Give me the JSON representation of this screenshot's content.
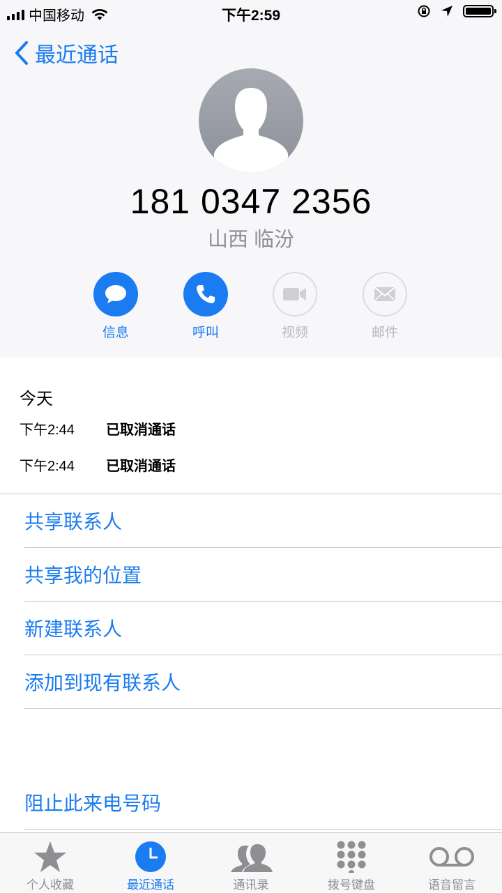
{
  "status_bar": {
    "carrier": "中国移动",
    "time": "下午2:59"
  },
  "nav": {
    "back_label": "最近通话"
  },
  "contact": {
    "number": "181 0347 2356",
    "location": "山西 临汾"
  },
  "actions": [
    {
      "label": "信息",
      "enabled": true
    },
    {
      "label": "呼叫",
      "enabled": true
    },
    {
      "label": "视频",
      "enabled": false
    },
    {
      "label": "邮件",
      "enabled": false
    }
  ],
  "history": {
    "day": "今天",
    "calls": [
      {
        "time": "下午2:44",
        "status": "已取消通话"
      },
      {
        "time": "下午2:44",
        "status": "已取消通话"
      }
    ]
  },
  "options": [
    "共享联系人",
    "共享我的位置",
    "新建联系人",
    "添加到现有联系人"
  ],
  "block": "阻止此来电号码",
  "tabs": [
    {
      "label": "个人收藏",
      "icon": "star-icon",
      "selected": false
    },
    {
      "label": "最近通话",
      "icon": "clock-icon",
      "selected": true
    },
    {
      "label": "通讯录",
      "icon": "contacts-icon",
      "selected": false
    },
    {
      "label": "拨号键盘",
      "icon": "keypad-icon",
      "selected": false
    },
    {
      "label": "语音留言",
      "icon": "voicemail-icon",
      "selected": false
    }
  ],
  "colors": {
    "accent": "#1a7cf0",
    "disabled": "#b8b8bd",
    "secondary": "#8e8e93"
  }
}
